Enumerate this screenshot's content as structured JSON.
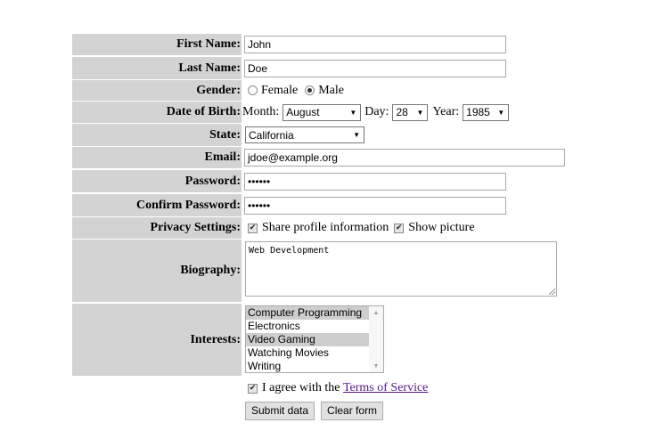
{
  "labels": {
    "first_name": "First Name:",
    "last_name": "Last Name:",
    "gender": "Gender:",
    "dob": "Date of Birth:",
    "state": "State:",
    "email": "Email:",
    "password": "Password:",
    "confirm_password": "Confirm Password:",
    "privacy": "Privacy Settings:",
    "biography": "Biography:",
    "interests": "Interests:"
  },
  "fields": {
    "first_name": "John",
    "last_name": "Doe",
    "gender_female": "Female",
    "gender_male": "Male",
    "gender_selected": "Male",
    "dob_month_label": "Month:",
    "dob_month": "August",
    "dob_day_label": "Day:",
    "dob_day": "28",
    "dob_year_label": "Year:",
    "dob_year": "1985",
    "state": "California",
    "email": "jdoe@example.org",
    "password": "••••••",
    "confirm_password": "••••••",
    "privacy_share": "Share profile information",
    "privacy_picture": "Show picture",
    "biography": "Web Development"
  },
  "interests": [
    {
      "label": "Computer Programming",
      "selected": true
    },
    {
      "label": "Electronics",
      "selected": false
    },
    {
      "label": "Video Gaming",
      "selected": true
    },
    {
      "label": "Watching Movies",
      "selected": false
    },
    {
      "label": "Writing",
      "selected": false
    }
  ],
  "agree": {
    "prefix": "I agree with the",
    "link": "Terms of Service"
  },
  "buttons": {
    "submit": "Submit data",
    "clear": "Clear form"
  },
  "colors": {
    "label_bg": "#d3d3d3",
    "link": "#551a8b",
    "selected_option": "#cecece"
  }
}
